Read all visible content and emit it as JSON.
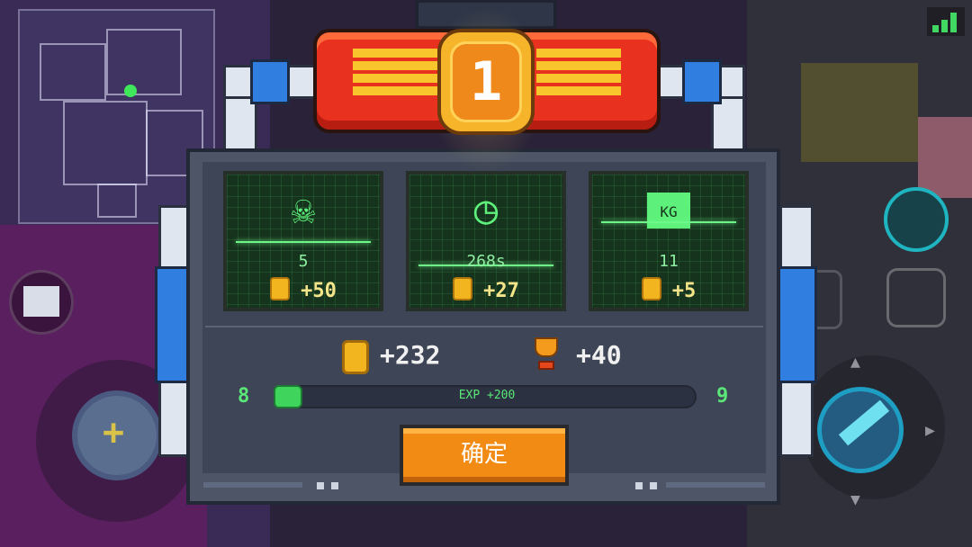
{
  "rank": "1",
  "stats": [
    {
      "icon": "skull-icon",
      "value": "5",
      "reward": "+50"
    },
    {
      "icon": "clock-icon",
      "value": "268s",
      "reward": "+27"
    },
    {
      "icon": "weight-icon",
      "icon_text": "KG",
      "value": "11",
      "reward": "+5"
    }
  ],
  "totals": {
    "coins": "+232",
    "trophies": "+40"
  },
  "experience": {
    "current_level": "8",
    "next_level": "9",
    "gain_label": "EXP +200",
    "progress": 0.03
  },
  "confirm_label": "确定",
  "colors": {
    "accent": "#f28b14",
    "banner": "#e9311f",
    "screen_green": "#5df07a",
    "coin": "#f3b51f"
  }
}
